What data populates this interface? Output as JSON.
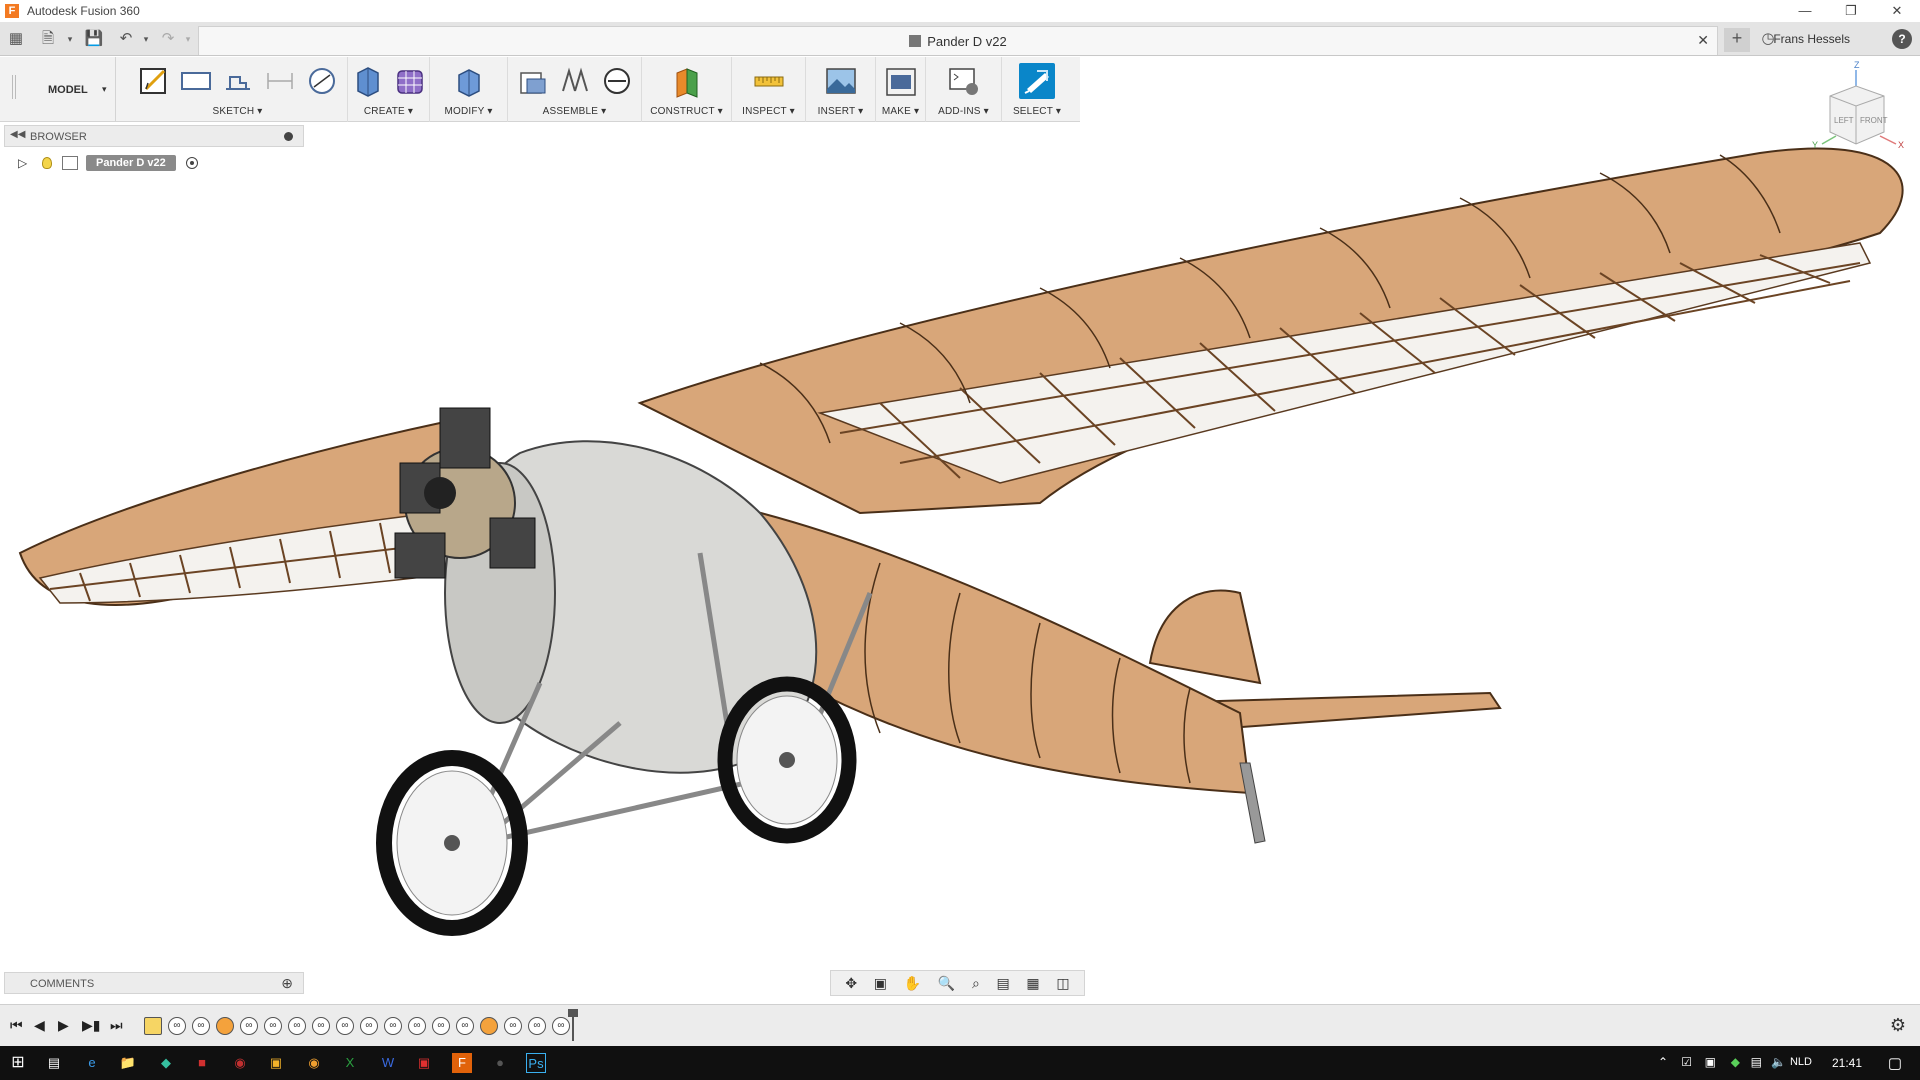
{
  "window": {
    "app_title": "Autodesk Fusion 360",
    "logo_letter": "F"
  },
  "tabbar": {
    "doc_title": "Pander D v22",
    "user_name": "Frans Hessels"
  },
  "toolbar": {
    "workspace": "MODEL",
    "groups": [
      {
        "label": "SKETCH"
      },
      {
        "label": "CREATE"
      },
      {
        "label": "MODIFY"
      },
      {
        "label": "ASSEMBLE"
      },
      {
        "label": "CONSTRUCT"
      },
      {
        "label": "INSPECT"
      },
      {
        "label": "INSERT"
      },
      {
        "label": "MAKE"
      },
      {
        "label": "ADD-INS"
      },
      {
        "label": "SELECT"
      }
    ]
  },
  "browser": {
    "title": "BROWSER",
    "root_node": "Pander D v22"
  },
  "viewcube": {
    "left": "LEFT",
    "front": "FRONT",
    "axis_z": "Z",
    "axis_y": "Y",
    "axis_x": "X"
  },
  "comments": {
    "title": "COMMENTS"
  },
  "taskbar": {
    "lang": "NLD",
    "clock": "21:41"
  },
  "colors": {
    "accent": "#0a86c9",
    "wood": "#d8a679",
    "fusion_orange": "#f37a22"
  }
}
